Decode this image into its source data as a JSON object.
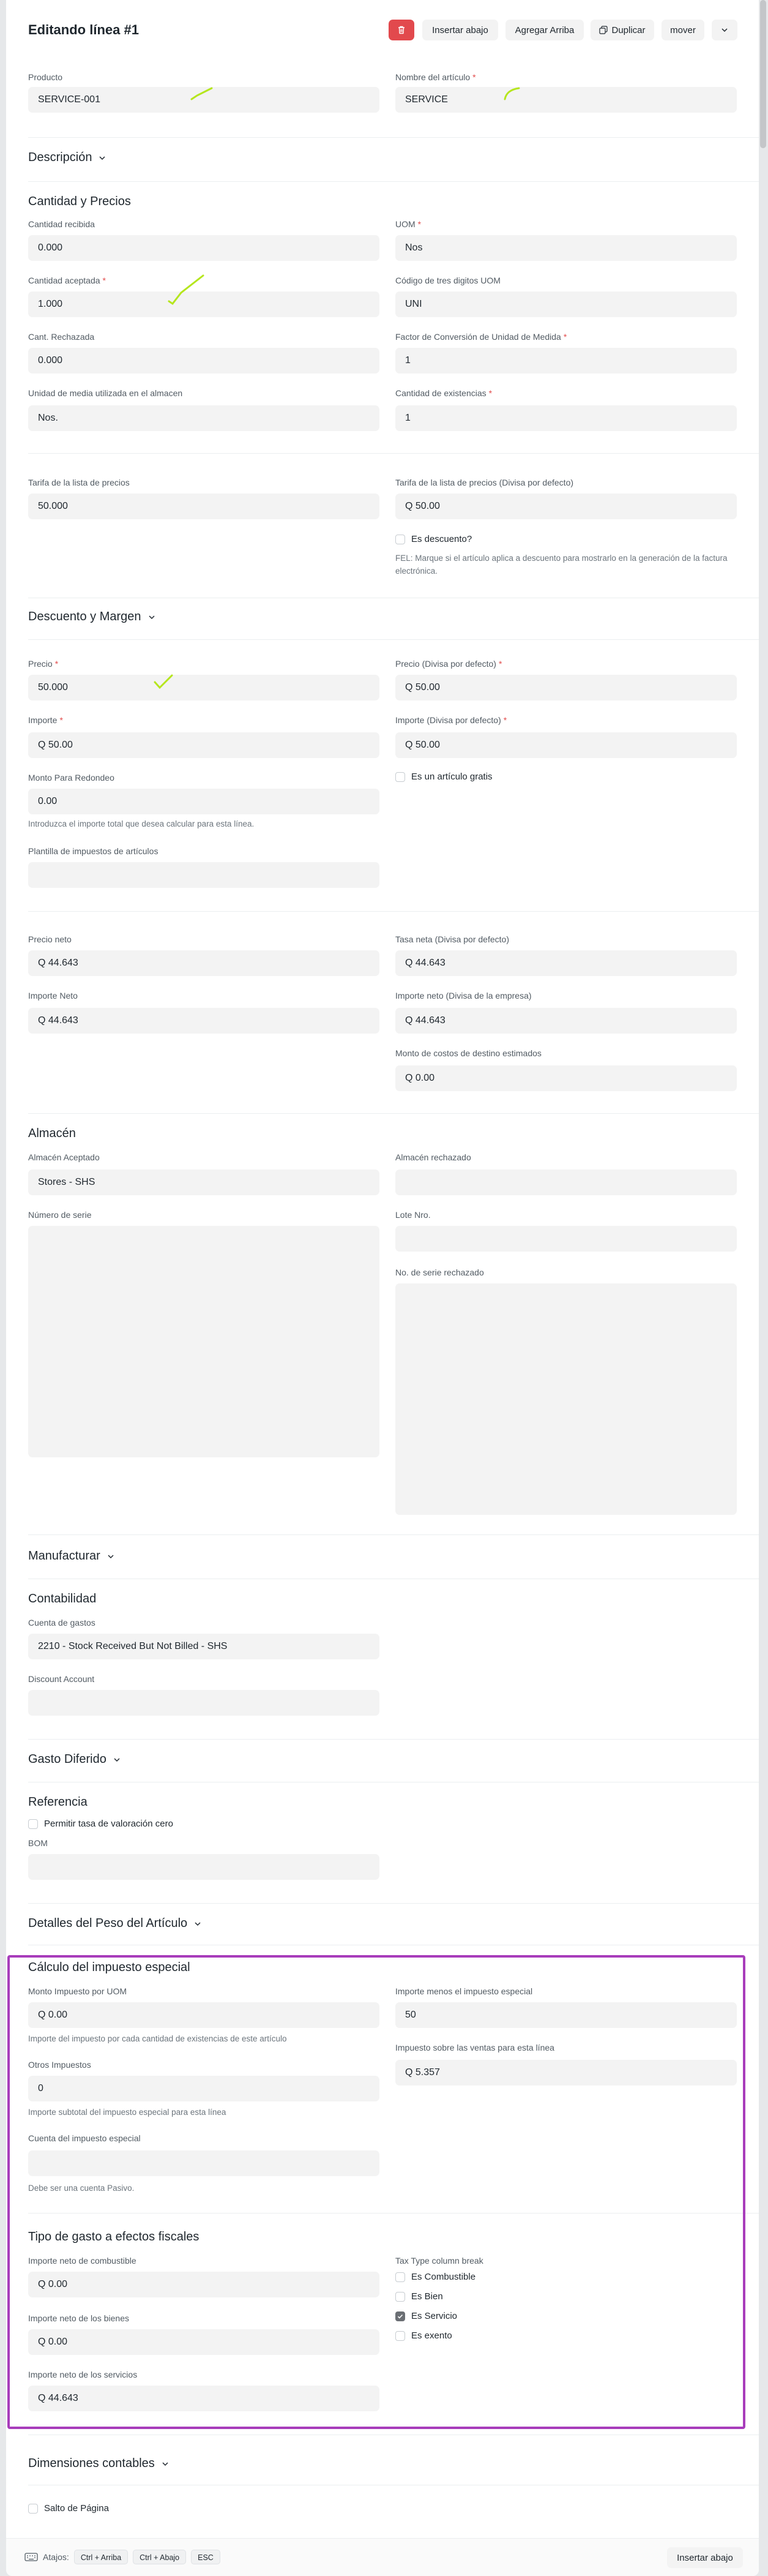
{
  "header": {
    "title": "Editando línea #1",
    "buttons": {
      "delete": "",
      "insert_below": "Insertar abajo",
      "add_above": "Agregar Arriba",
      "duplicate": "Duplicar",
      "move": "mover"
    }
  },
  "item": {
    "product": {
      "label": "Producto",
      "value": "SERVICE-001"
    },
    "item_name": {
      "label": "Nombre del artículo",
      "value": "SERVICE"
    }
  },
  "description": {
    "title": "Descripción"
  },
  "qty_rates": {
    "title": "Cantidad y Precios",
    "received_qty": {
      "label": "Cantidad recibida",
      "value": "0.000"
    },
    "uom": {
      "label": "UOM",
      "value": "Nos"
    },
    "accepted_qty": {
      "label": "Cantidad aceptada",
      "value": "1.000"
    },
    "uom_code": {
      "label": "Código de tres digitos UOM",
      "value": "UNI"
    },
    "rejected_qty": {
      "label": "Cant. Rechazada",
      "value": "0.000"
    },
    "conversion_factor": {
      "label": "Factor de Conversión de Unidad de Medida",
      "value": "1"
    },
    "stock_uom": {
      "label": "Unidad de media utilizada en el almacen",
      "value": "Nos."
    },
    "stock_qty": {
      "label": "Cantidad de existencias",
      "value": "1"
    },
    "price_list_rate": {
      "label": "Tarifa de la lista de precios",
      "value": "50.000"
    },
    "base_price_list_rate": {
      "label": "Tarifa de la lista de precios (Divisa por defecto)",
      "value": "Q 50.00"
    },
    "is_discount": {
      "label": "Es descuento?",
      "help": "FEL: Marque si el artículo aplica a descuento para mostrarlo en la generación de la factura electrónica."
    }
  },
  "discount_margin": {
    "title": "Descuento y Margen",
    "rate": {
      "label": "Precio",
      "value": "50.000"
    },
    "base_rate": {
      "label": "Precio (Divisa por defecto)",
      "value": "Q 50.00"
    },
    "amount": {
      "label": "Importe",
      "value": "Q 50.00"
    },
    "base_amount": {
      "label": "Importe (Divisa por defecto)",
      "value": "Q 50.00"
    },
    "rounding_amount": {
      "label": "Monto Para Redondeo",
      "value": "0.00",
      "help": "Introduzca el importe total que desea calcular para esta línea."
    },
    "is_free_item": {
      "label": "Es un artículo gratis"
    },
    "tax_template": {
      "label": "Plantilla de impuestos de artículos",
      "value": ""
    }
  },
  "net": {
    "net_rate": {
      "label": "Precio neto",
      "value": "Q 44.643"
    },
    "base_net_rate": {
      "label": "Tasa neta (Divisa por defecto)",
      "value": "Q 44.643"
    },
    "net_amount": {
      "label": "Importe Neto",
      "value": "Q 44.643"
    },
    "base_net_amount": {
      "label": "Importe neto (Divisa de la empresa)",
      "value": "Q 44.643"
    },
    "landed_cost": {
      "label": "Monto de costos de destino estimados",
      "value": "Q 0.00"
    }
  },
  "warehouse": {
    "title": "Almacén",
    "accepted": {
      "label": "Almacén Aceptado",
      "value": "Stores - SHS"
    },
    "rejected": {
      "label": "Almacén rechazado",
      "value": ""
    },
    "serial_no": {
      "label": "Número de serie",
      "value": ""
    },
    "batch_no": {
      "label": "Lote Nro.",
      "value": ""
    },
    "rejected_serial": {
      "label": "No. de serie rechazado",
      "value": ""
    }
  },
  "manufacturing": {
    "title": "Manufacturar"
  },
  "accounting": {
    "title": "Contabilidad",
    "expense_account": {
      "label": "Cuenta de gastos",
      "value": "2210 - Stock Received But Not Billed - SHS"
    },
    "discount_account": {
      "label": "Discount Account",
      "value": ""
    }
  },
  "deferred": {
    "title": "Gasto Diferido"
  },
  "reference": {
    "title": "Referencia",
    "allow_zero_valuation": {
      "label": "Permitir tasa de valoración cero"
    },
    "bom": {
      "label": "BOM",
      "value": ""
    }
  },
  "weight": {
    "title": "Detalles del Peso del Artículo"
  },
  "special_tax": {
    "title": "Cálculo del impuesto especial",
    "per_uom": {
      "label": "Monto Impuesto por UOM",
      "value": "Q 0.00",
      "help": "Importe del impuesto por cada cantidad de existencias de este artículo"
    },
    "amount_minus": {
      "label": "Importe menos el impuesto especial",
      "value": "50"
    },
    "sales_tax": {
      "label": "Impuesto sobre las ventas para esta línea",
      "value": "Q 5.357"
    },
    "other_taxes": {
      "label": "Otros Impuestos",
      "value": "0",
      "help": "Importe subtotal del impuesto especial para esta línea"
    },
    "tax_account": {
      "label": "Cuenta del impuesto especial",
      "value": "",
      "help": "Debe ser una cuenta Pasivo."
    }
  },
  "expense_type": {
    "title": "Tipo de gasto a efectos fiscales",
    "fuel": {
      "label": "Importe neto de combustible",
      "value": "Q 0.00"
    },
    "goods": {
      "label": "Importe neto de los bienes",
      "value": "Q 0.00"
    },
    "services": {
      "label": "Importe neto de los servicios",
      "value": "Q 44.643"
    },
    "column_break": "Tax Type column break",
    "options": [
      {
        "label": "Es Combustible",
        "checked": false
      },
      {
        "label": "Es Bien",
        "checked": false
      },
      {
        "label": "Es Servicio",
        "checked": true
      },
      {
        "label": "Es exento",
        "checked": false
      }
    ]
  },
  "dimensions": {
    "title": "Dimensiones contables"
  },
  "page_break": {
    "label": "Salto de Página"
  },
  "footer": {
    "shortcuts_label": "Atajos:",
    "shortcuts": [
      "Ctrl + Arriba",
      "Ctrl + Abajo",
      "ESC"
    ],
    "insert_below": "Insertar abajo"
  },
  "colors": {
    "danger": "#e2494d",
    "highlight": "#a83dbb",
    "annotation": "#b5e61d"
  }
}
